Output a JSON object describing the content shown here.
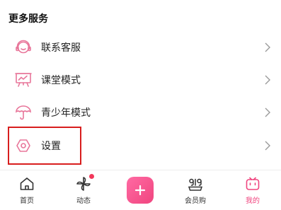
{
  "section": {
    "title": "更多服务"
  },
  "menu": [
    {
      "label": "联系客服",
      "icon": "headset-icon"
    },
    {
      "label": "课堂模式",
      "icon": "classroom-icon"
    },
    {
      "label": "青少年模式",
      "icon": "umbrella-icon"
    },
    {
      "label": "设置",
      "icon": "hexagon-settings-icon"
    }
  ],
  "tabbar": {
    "home": "首页",
    "feed": "动态",
    "vip": "会员购",
    "mine": "我的"
  },
  "colors": {
    "accent": "#f0457f",
    "highlight": "#d81e1e",
    "badge": "#f2385a"
  }
}
